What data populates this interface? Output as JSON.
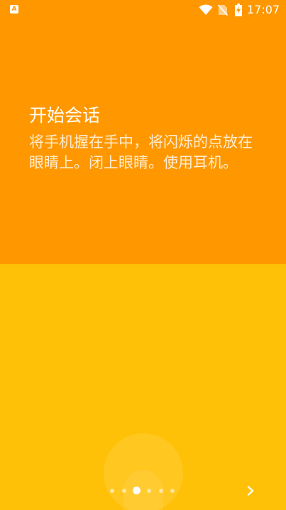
{
  "status_bar": {
    "notification_icon": "a-box-icon",
    "notification_glyph": "A",
    "wifi_icon": "wifi-icon",
    "sim_icon": "no-sim-icon",
    "battery_icon": "battery-charging-icon",
    "time": "17:07"
  },
  "onboarding": {
    "title": "开始会话",
    "description": "将手机握在手中，将闪烁的点放在眼睛上。闭上眼睛。使用耳机。",
    "illustration_icon": "person-illustration"
  },
  "pager": {
    "page_count": 6,
    "active_page": 3,
    "next_icon": "chevron-right-icon"
  },
  "colors": {
    "top_panel": "#FF9800",
    "bottom_panel": "#FFC107",
    "text": "#FFFFFF"
  }
}
